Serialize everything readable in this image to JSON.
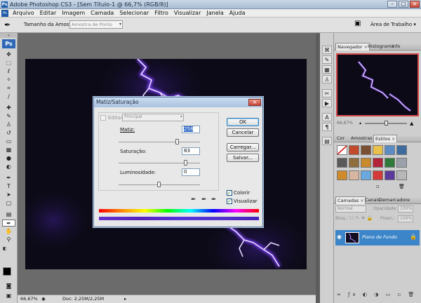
{
  "window": {
    "title": "Adobe Photoshop CS3 - [Sem Título-1 @ 66,7% (RGB/8)]"
  },
  "menu": [
    "Arquivo",
    "Editar",
    "Imagem",
    "Camada",
    "Selecionar",
    "Filtro",
    "Visualizar",
    "Janela",
    "Ajuda"
  ],
  "options": {
    "sample_label": "Tamanho da Amostra:",
    "sample_value": "Amostra de Ponto",
    "workspace_label": "Área de Trabalho ▾"
  },
  "toolbox": {
    "ps_label": "Ps"
  },
  "status": {
    "zoom": "66,67%",
    "doc": "Doc: 2,25M/2,25M"
  },
  "navigator": {
    "tabs": [
      "Navegador",
      "Histograma",
      "Info"
    ],
    "zoom": "66,67%"
  },
  "swatches": {
    "tabs": [
      "Cor",
      "Amostras",
      "Estilos"
    ]
  },
  "layers": {
    "tabs": [
      "Camadas",
      "Canais",
      "Demarcadores"
    ],
    "blend": "Normal",
    "opacity_label": "Opacidade:",
    "opacity_value": "100%",
    "lock_label": "Bloq.:",
    "fill_label": "Preen.:",
    "fill_value": "100%",
    "layer_name": "Plano de Fundo"
  },
  "dialog": {
    "title": "Matiz/Saturação",
    "edit_label": "Editar:",
    "edit_value": "Principal",
    "hue_label": "Matiz:",
    "hue_value": "258",
    "sat_label": "Saturação:",
    "sat_value": "83",
    "light_label": "Luminosidade:",
    "light_value": "0",
    "buttons": {
      "ok": "OK",
      "cancel": "Cancelar",
      "load": "Carregar...",
      "save": "Salvar..."
    },
    "colorize_label": "Colorir",
    "colorize_checked": true,
    "preview_label": "Visualizar",
    "preview_checked": true,
    "levels": {
      "hue": 0.72,
      "sat": 0.83,
      "light": 0.5
    }
  },
  "colors": {
    "accent_blue": "#3b85c8",
    "lightning": "#b77bff",
    "canvas_bg": "#0c0a16"
  }
}
